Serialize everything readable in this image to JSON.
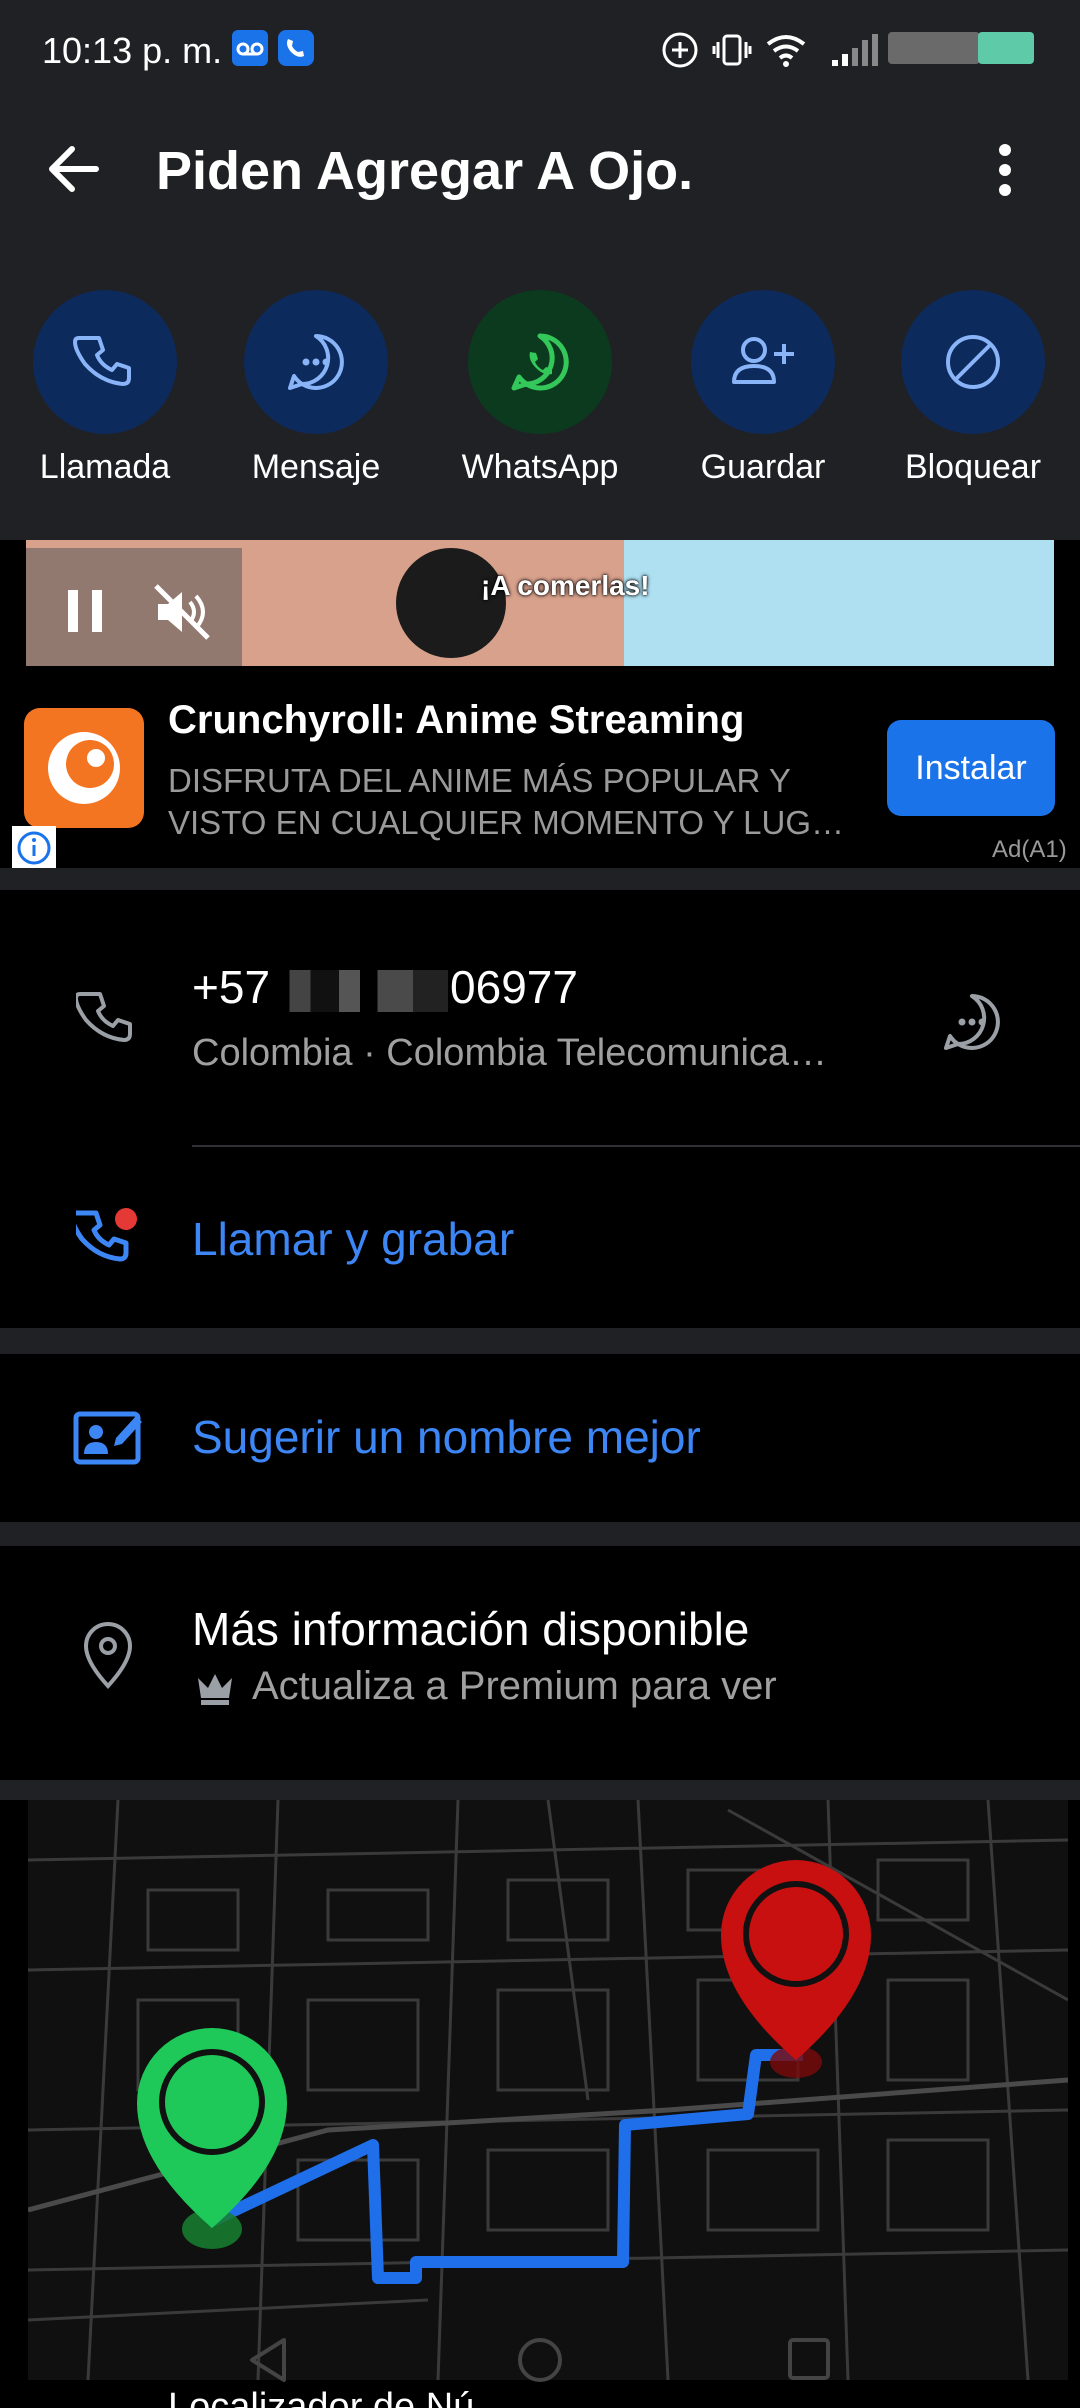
{
  "status": {
    "time": "10:13 p. m."
  },
  "header": {
    "title": "Piden Agregar A Ojo."
  },
  "actions": [
    {
      "label": "Llamada",
      "icon": "phone-icon"
    },
    {
      "label": "Mensaje",
      "icon": "message-icon"
    },
    {
      "label": "WhatsApp",
      "icon": "whatsapp-icon"
    },
    {
      "label": "Guardar",
      "icon": "add-contact-icon"
    },
    {
      "label": "Bloquear",
      "icon": "block-icon"
    }
  ],
  "ad": {
    "video_subtitle": "¡A comerlas!",
    "title": "Crunchyroll: Anime Streaming",
    "desc_line1": "DISFRUTA DEL ANIME MÁS POPULAR Y",
    "desc_line2": "VISTO EN CUALQUIER MOMENTO Y LUG…",
    "install_label": "Instalar",
    "ad_label": "Ad(A1)"
  },
  "contact": {
    "number_prefix": "+57",
    "number_suffix": "06977",
    "subtitle": "Colombia · Colombia Telecomunica…",
    "call_record": "Llamar y grabar",
    "suggest_name": "Sugerir un nombre mejor",
    "more_info_title": "Más información disponible",
    "more_info_sub": "Actualiza a Premium para ver"
  },
  "next_section": {
    "label": "Localizador de Nú..."
  },
  "colors": {
    "accent": "#3d86f5",
    "action_circle": "#0d2a5c",
    "whatsapp_circle": "#0b3a1f",
    "whatsapp_green": "#34c759",
    "pin_green": "#1ec95a",
    "pin_red": "#c81010"
  }
}
